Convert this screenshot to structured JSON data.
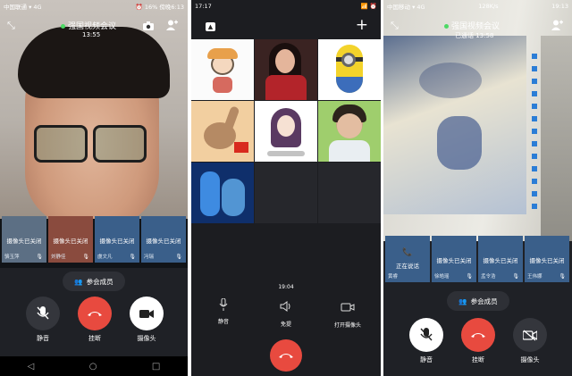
{
  "phone1": {
    "status_left": "中国联通 ▾ 4G",
    "status_right": "⏰ 16% 傍晚6:13",
    "meeting_title": "强国视频会议",
    "meeting_time": "13:55",
    "thumbs": [
      {
        "label": "摄像头已关闭",
        "name": "骆玉萍"
      },
      {
        "label": "摄像头已关闭",
        "name": "刘静佳"
      },
      {
        "label": "摄像头已关闭",
        "name": "虞文凡"
      },
      {
        "label": "摄像头已关闭",
        "name": "冯瑞"
      }
    ],
    "members_label": "参会成员",
    "controls": {
      "mute": "静音",
      "hangup": "挂断",
      "camera": "摄像头"
    }
  },
  "phone2": {
    "status_left": "17:17",
    "status_right": "📶 ⏰",
    "timer": "19:04",
    "controls": {
      "mute": "静音",
      "speaker": "免提",
      "camera": "打开摄像头"
    }
  },
  "phone3": {
    "status_left": "中国移动 ▾ 4G",
    "status_mid": "128K/s",
    "status_right": "19:13",
    "meeting_title": "强国视频会议",
    "meeting_time": "已通话 13:58",
    "thumbs": [
      {
        "label": "摄像头已关闭",
        "name": "黄睿"
      },
      {
        "label": "摄像头已关闭",
        "name": "徐皓瑶"
      },
      {
        "label": "摄像头已关闭",
        "name": "孟令浩"
      },
      {
        "label": "摄像头已关闭",
        "name": "王伟娜"
      }
    ],
    "speaking_label": "正在说话",
    "members_label": "参会成员",
    "controls": {
      "mute": "静音",
      "hangup": "挂断",
      "camera": "摄像头"
    }
  },
  "colors": {
    "hangup": "#e84a3f",
    "bg": "#1f2126",
    "thumb": "#3a5f8a"
  }
}
